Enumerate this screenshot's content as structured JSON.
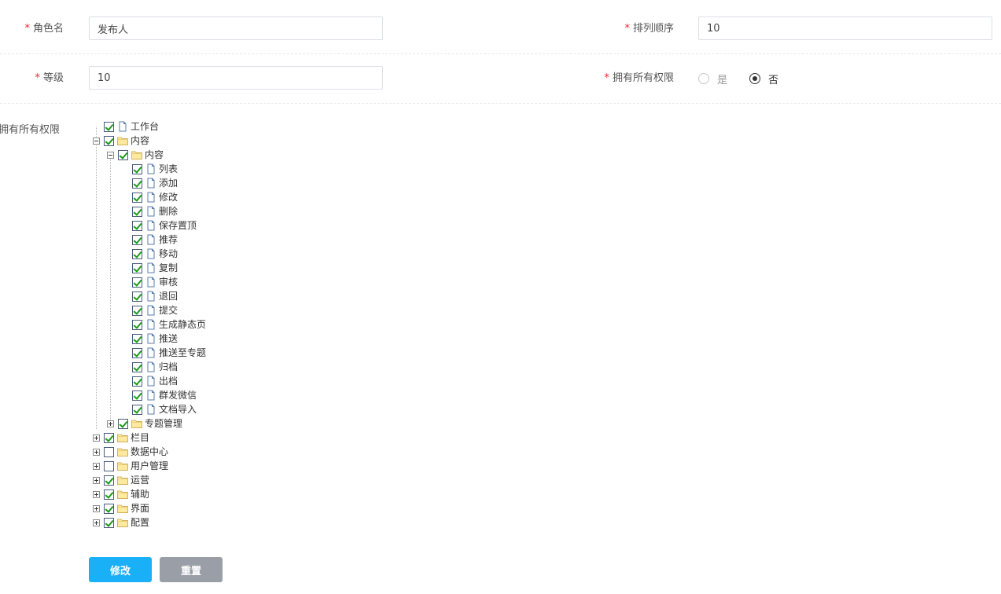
{
  "form": {
    "role_name": {
      "label": "角色名",
      "value": "发布人"
    },
    "sort_order": {
      "label": "排列顺序",
      "value": "10"
    },
    "level": {
      "label": "等级",
      "value": "10"
    },
    "all_perms": {
      "label": "拥有所有权限",
      "options": [
        {
          "label": "是",
          "checked": false
        },
        {
          "label": "否",
          "checked": true
        }
      ]
    },
    "tree_label": "拥有所有权限",
    "required_mark": "*"
  },
  "tree": [
    {
      "label": "工作台",
      "level": 0,
      "type": "file",
      "checked": true
    },
    {
      "label": "内容",
      "level": 0,
      "type": "folder",
      "checked": true,
      "expanded": true
    },
    {
      "label": "内容",
      "level": 1,
      "type": "folder",
      "checked": true,
      "expanded": true
    },
    {
      "label": "列表",
      "level": 2,
      "type": "file",
      "checked": true
    },
    {
      "label": "添加",
      "level": 2,
      "type": "file",
      "checked": true
    },
    {
      "label": "修改",
      "level": 2,
      "type": "file",
      "checked": true
    },
    {
      "label": "删除",
      "level": 2,
      "type": "file",
      "checked": true
    },
    {
      "label": "保存置顶",
      "level": 2,
      "type": "file",
      "checked": true
    },
    {
      "label": "推荐",
      "level": 2,
      "type": "file",
      "checked": true
    },
    {
      "label": "移动",
      "level": 2,
      "type": "file",
      "checked": true
    },
    {
      "label": "复制",
      "level": 2,
      "type": "file",
      "checked": true
    },
    {
      "label": "审核",
      "level": 2,
      "type": "file",
      "checked": true
    },
    {
      "label": "退回",
      "level": 2,
      "type": "file",
      "checked": true
    },
    {
      "label": "提交",
      "level": 2,
      "type": "file",
      "checked": true
    },
    {
      "label": "生成静态页",
      "level": 2,
      "type": "file",
      "checked": true
    },
    {
      "label": "推送",
      "level": 2,
      "type": "file",
      "checked": true
    },
    {
      "label": "推送至专题",
      "level": 2,
      "type": "file",
      "checked": true
    },
    {
      "label": "归档",
      "level": 2,
      "type": "file",
      "checked": true
    },
    {
      "label": "出档",
      "level": 2,
      "type": "file",
      "checked": true
    },
    {
      "label": "群发微信",
      "level": 2,
      "type": "file",
      "checked": true
    },
    {
      "label": "文档导入",
      "level": 2,
      "type": "file",
      "checked": true
    },
    {
      "label": "专题管理",
      "level": 1,
      "type": "folder",
      "checked": true,
      "expanded": false
    },
    {
      "label": "栏目",
      "level": 0,
      "type": "folder",
      "checked": true,
      "expanded": false
    },
    {
      "label": "数据中心",
      "level": 0,
      "type": "folder",
      "checked": false,
      "expanded": false
    },
    {
      "label": "用户管理",
      "level": 0,
      "type": "folder",
      "checked": false,
      "expanded": false
    },
    {
      "label": "运营",
      "level": 0,
      "type": "folder",
      "checked": true,
      "expanded": false
    },
    {
      "label": "辅助",
      "level": 0,
      "type": "folder",
      "checked": true,
      "expanded": false
    },
    {
      "label": "界面",
      "level": 0,
      "type": "folder",
      "checked": true,
      "expanded": false
    },
    {
      "label": "配置",
      "level": 0,
      "type": "folder",
      "checked": true,
      "expanded": false
    }
  ],
  "buttons": {
    "submit": {
      "label": "修改",
      "color": "#1ab0f8"
    },
    "reset": {
      "label": "重置",
      "color": "#9a9ea6"
    }
  }
}
